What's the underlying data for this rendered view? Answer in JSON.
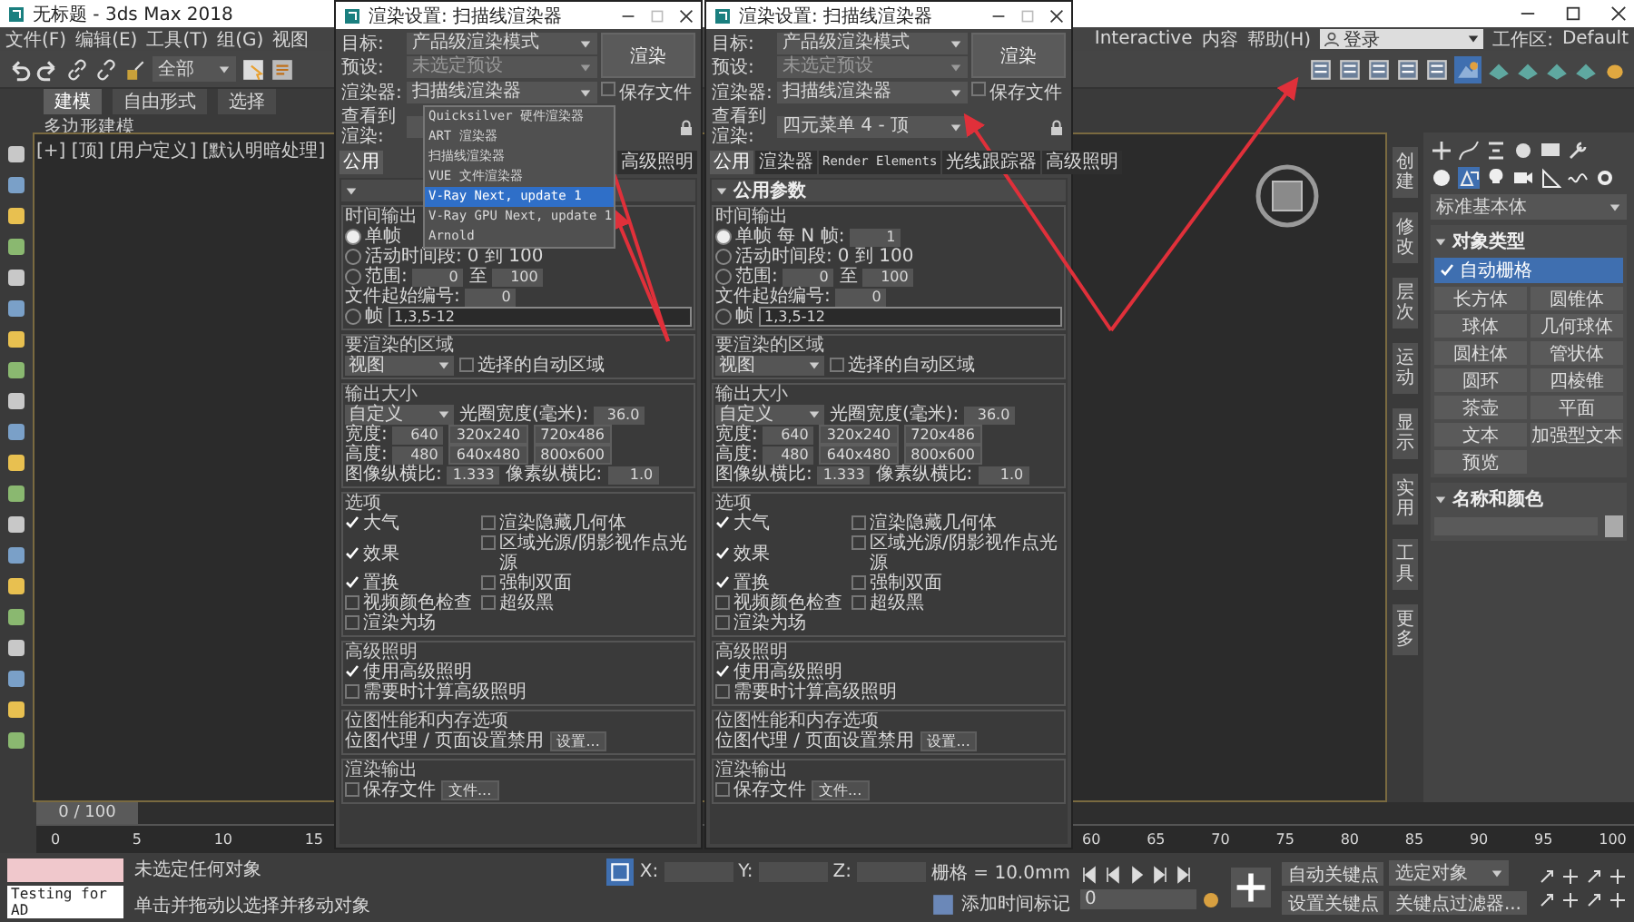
{
  "app": {
    "title": "无标题 - 3ds Max 2018",
    "menu_left": [
      "文件(F)",
      "编辑(E)",
      "工具(T)",
      "组(G)",
      "视图"
    ],
    "menu_right": [
      "Interactive",
      "内容",
      "帮助(H)"
    ],
    "sign_in": "登录",
    "workspace_label": "工作区:",
    "workspace": "Default",
    "selection_filter": "全部",
    "ribbon_tabs": [
      {
        "label": "建模",
        "selected": true
      },
      {
        "label": "自由形式",
        "selected": false
      },
      {
        "label": "选择",
        "selected": false
      }
    ],
    "ribbon_sub": "多边形建模",
    "viewport_label": "[+] [顶] [用户定义] [默认明暗处理]",
    "side_tabs": [
      "创建",
      "修改",
      "层次",
      "运动",
      "显示",
      "实用",
      "工具",
      "更多"
    ],
    "command_panel": {
      "category": "标准基本体",
      "rollout": "对象类型",
      "autogrid": {
        "label": "自动栅格",
        "checked": true
      },
      "objects": [
        "长方体",
        "圆锥体",
        "球体",
        "几何球体",
        "圆柱体",
        "管状体",
        "圆环",
        "四棱锥",
        "茶壶",
        "平面",
        "文本",
        "加强型文本",
        "预览"
      ],
      "name_rollout": "名称和颜色"
    },
    "timeline": {
      "slider": "0 / 100",
      "level": 0,
      "left_ticks": [
        "0",
        "5",
        "10",
        "15"
      ],
      "right_ticks": [
        "60",
        "65",
        "70",
        "75",
        "80",
        "85",
        "90",
        "95",
        "100"
      ]
    },
    "status": {
      "script": "Testing for AD",
      "line1": "未选定任何对象",
      "line2": "单击并拖动以选择并移动对象",
      "x_label": "X:",
      "y_label": "Y:",
      "z_label": "Z:",
      "grid": "栅格 = 10.0mm",
      "time_tag": "添加时间标记",
      "frame": "0",
      "auto_key": "自动关键点",
      "selected_obj": "选定对象",
      "set_key": "设置关键点",
      "key_filters": "关键点过滤器..."
    }
  },
  "dialogs": [
    {
      "title": "渲染设置: 扫描线渲染器",
      "target_label": "目标:",
      "target": "产品级渲染模式",
      "preset_label": "预设:",
      "preset": "未选定预设",
      "renderer_label": "渲染器:",
      "renderer": "扫描线渲染器",
      "save_file": {
        "label": "保存文件",
        "checked": false
      },
      "view_label": "查看到渲染:",
      "render_button": "渲染",
      "tabs": [
        {
          "label": "公用",
          "selected": true
        },
        {
          "label": "高级照明",
          "selected": false
        }
      ],
      "dropdown": [
        {
          "label": "Quicksilver 硬件渲染器",
          "selected": false
        },
        {
          "label": "ART 渲染器",
          "selected": false
        },
        {
          "label": "扫描线渲染器",
          "selected": false
        },
        {
          "label": "VUE 文件渲染器",
          "selected": false
        },
        {
          "label": "V-Ray Next, update 1",
          "selected": true
        },
        {
          "label": "V-Ray GPU Next, update 1",
          "selected": false
        },
        {
          "label": "Arnold",
          "selected": false
        }
      ],
      "sections": [
        {
          "heading": "时间输出",
          "rows": [
            {
              "items": [
                {
                  "kind": "radio",
                  "label": "单帧",
                  "selected": true
                }
              ]
            },
            {
              "items": [
                {
                  "kind": "radio",
                  "label": "活动时间段:",
                  "selected": false
                },
                {
                  "kind": "text",
                  "text": "0 到 100"
                }
              ]
            },
            {
              "items": [
                {
                  "kind": "radio",
                  "label": "范围:",
                  "selected": false
                },
                {
                  "kind": "field",
                  "value": "0"
                },
                {
                  "kind": "text",
                  "text": "至"
                },
                {
                  "kind": "field",
                  "value": "100"
                }
              ]
            },
            {
              "items": [
                {
                  "kind": "text",
                  "text": "文件起始编号:"
                },
                {
                  "kind": "field",
                  "value": "0"
                }
              ]
            },
            {
              "items": [
                {
                  "kind": "radio",
                  "label": "帧",
                  "selected": false
                },
                {
                  "kind": "input",
                  "value": "1,3,5-12"
                }
              ]
            }
          ]
        },
        {
          "heading": "要渲染的区域",
          "rows": [
            {
              "items": [
                {
                  "kind": "select",
                  "value": "视图"
                },
                {
                  "kind": "check",
                  "label": "选择的自动区域",
                  "checked": false
                }
              ]
            }
          ]
        },
        {
          "heading": "输出大小",
          "rows": [
            {
              "items": [
                {
                  "kind": "select",
                  "value": "自定义"
                },
                {
                  "kind": "text",
                  "text": "光圈宽度(毫米):"
                },
                {
                  "kind": "field",
                  "value": "36.0"
                }
              ]
            },
            {
              "items": [
                {
                  "kind": "text",
                  "text": "宽度:"
                },
                {
                  "kind": "field",
                  "value": "640"
                },
                {
                  "kind": "button",
                  "label": "320x240"
                },
                {
                  "kind": "button",
                  "label": "720x486"
                }
              ]
            },
            {
              "items": [
                {
                  "kind": "text",
                  "text": "高度:"
                },
                {
                  "kind": "field",
                  "value": "480"
                },
                {
                  "kind": "button",
                  "label": "640x480"
                },
                {
                  "kind": "button",
                  "label": "800x600"
                }
              ]
            },
            {
              "items": [
                {
                  "kind": "text",
                  "text": "图像纵横比:"
                },
                {
                  "kind": "field",
                  "value": "1.333"
                },
                {
                  "kind": "text",
                  "text": "像素纵横比:"
                },
                {
                  "kind": "field",
                  "value": "1.0"
                }
              ]
            }
          ]
        },
        {
          "heading": "选项",
          "rows": [
            {
              "items": [
                {
                  "kind": "check",
                  "label": "大气",
                  "checked": true
                },
                {
                  "kind": "check",
                  "label": "渲染隐藏几何体",
                  "checked": false
                }
              ]
            },
            {
              "items": [
                {
                  "kind": "check",
                  "label": "效果",
                  "checked": true
                },
                {
                  "kind": "check",
                  "label": "区域光源/阴影视作点光源",
                  "checked": false
                }
              ]
            },
            {
              "items": [
                {
                  "kind": "check",
                  "label": "置换",
                  "checked": true
                },
                {
                  "kind": "check",
                  "label": "强制双面",
                  "checked": false
                }
              ]
            },
            {
              "items": [
                {
                  "kind": "check",
                  "label": "视频颜色检查",
                  "checked": false
                },
                {
                  "kind": "check",
                  "label": "超级黑",
                  "checked": false
                }
              ]
            },
            {
              "items": [
                {
                  "kind": "check",
                  "label": "渲染为场",
                  "checked": false
                }
              ]
            }
          ]
        },
        {
          "heading": "高级照明",
          "rows": [
            {
              "items": [
                {
                  "kind": "check",
                  "label": "使用高级照明",
                  "checked": true
                }
              ]
            },
            {
              "items": [
                {
                  "kind": "check",
                  "label": "需要时计算高级照明",
                  "checked": false
                }
              ]
            }
          ]
        },
        {
          "heading": "位图性能和内存选项",
          "rows": [
            {
              "items": [
                {
                  "kind": "text",
                  "text": "位图代理 / 页面设置禁用"
                },
                {
                  "kind": "button",
                  "label": "设置..."
                }
              ]
            }
          ]
        },
        {
          "heading": "渲染输出",
          "rows": [
            {
              "items": [
                {
                  "kind": "check",
                  "label": "保存文件",
                  "checked": false
                },
                {
                  "kind": "button",
                  "label": "文件..."
                }
              ]
            }
          ]
        }
      ]
    },
    {
      "title": "渲染设置: 扫描线渲染器",
      "target_label": "目标:",
      "target": "产品级渲染模式",
      "preset_label": "预设:",
      "preset": "未选定预设",
      "renderer_label": "渲染器:",
      "renderer": "扫描线渲染器",
      "save_file": {
        "label": "保存文件",
        "checked": false
      },
      "view_label": "查看到渲染:",
      "view": "四元菜单 4 - 顶",
      "render_button": "渲染",
      "tabs": [
        {
          "label": "公用",
          "selected": true
        },
        {
          "label": "渲染器",
          "selected": false
        },
        {
          "label": "Render Elements",
          "selected": false
        },
        {
          "label": "光线跟踪器",
          "selected": false
        },
        {
          "label": "高级照明",
          "selected": false
        }
      ],
      "rollout": "公用参数",
      "sections": [
        {
          "heading": "时间输出",
          "rows": [
            {
              "items": [
                {
                  "kind": "radio",
                  "label": "单帧",
                  "selected": true
                },
                {
                  "kind": "text",
                  "text": "每 N 帧:"
                },
                {
                  "kind": "field",
                  "value": "1"
                }
              ]
            },
            {
              "items": [
                {
                  "kind": "radio",
                  "label": "活动时间段:",
                  "selected": false
                },
                {
                  "kind": "text",
                  "text": "0 到 100"
                }
              ]
            },
            {
              "items": [
                {
                  "kind": "radio",
                  "label": "范围:",
                  "selected": false
                },
                {
                  "kind": "field",
                  "value": "0"
                },
                {
                  "kind": "text",
                  "text": "至"
                },
                {
                  "kind": "field",
                  "value": "100"
                }
              ]
            },
            {
              "items": [
                {
                  "kind": "text",
                  "text": "文件起始编号:"
                },
                {
                  "kind": "field",
                  "value": "0"
                }
              ]
            },
            {
              "items": [
                {
                  "kind": "radio",
                  "label": "帧",
                  "selected": false
                },
                {
                  "kind": "input",
                  "value": "1,3,5-12"
                }
              ]
            }
          ]
        },
        {
          "heading": "要渲染的区域",
          "rows": [
            {
              "items": [
                {
                  "kind": "select",
                  "value": "视图"
                },
                {
                  "kind": "check",
                  "label": "选择的自动区域",
                  "checked": false
                }
              ]
            }
          ]
        },
        {
          "heading": "输出大小",
          "rows": [
            {
              "items": [
                {
                  "kind": "select",
                  "value": "自定义"
                },
                {
                  "kind": "text",
                  "text": "光圈宽度(毫米):"
                },
                {
                  "kind": "field",
                  "value": "36.0"
                }
              ]
            },
            {
              "items": [
                {
                  "kind": "text",
                  "text": "宽度:"
                },
                {
                  "kind": "field",
                  "value": "640"
                },
                {
                  "kind": "button",
                  "label": "320x240"
                },
                {
                  "kind": "button",
                  "label": "720x486"
                }
              ]
            },
            {
              "items": [
                {
                  "kind": "text",
                  "text": "高度:"
                },
                {
                  "kind": "field",
                  "value": "480"
                },
                {
                  "kind": "button",
                  "label": "640x480"
                },
                {
                  "kind": "button",
                  "label": "800x600"
                }
              ]
            },
            {
              "items": [
                {
                  "kind": "text",
                  "text": "图像纵横比:"
                },
                {
                  "kind": "field",
                  "value": "1.333"
                },
                {
                  "kind": "text",
                  "text": "像素纵横比:"
                },
                {
                  "kind": "field",
                  "value": "1.0"
                }
              ]
            }
          ]
        },
        {
          "heading": "选项",
          "rows": [
            {
              "items": [
                {
                  "kind": "check",
                  "label": "大气",
                  "checked": true
                },
                {
                  "kind": "check",
                  "label": "渲染隐藏几何体",
                  "checked": false
                }
              ]
            },
            {
              "items": [
                {
                  "kind": "check",
                  "label": "效果",
                  "checked": true
                },
                {
                  "kind": "check",
                  "label": "区域光源/阴影视作点光源",
                  "checked": false
                }
              ]
            },
            {
              "items": [
                {
                  "kind": "check",
                  "label": "置换",
                  "checked": true
                },
                {
                  "kind": "check",
                  "label": "强制双面",
                  "checked": false
                }
              ]
            },
            {
              "items": [
                {
                  "kind": "check",
                  "label": "视频颜色检查",
                  "checked": false
                },
                {
                  "kind": "check",
                  "label": "超级黑",
                  "checked": false
                }
              ]
            },
            {
              "items": [
                {
                  "kind": "check",
                  "label": "渲染为场",
                  "checked": false
                }
              ]
            }
          ]
        },
        {
          "heading": "高级照明",
          "rows": [
            {
              "items": [
                {
                  "kind": "check",
                  "label": "使用高级照明",
                  "checked": true
                }
              ]
            },
            {
              "items": [
                {
                  "kind": "check",
                  "label": "需要时计算高级照明",
                  "checked": false
                }
              ]
            }
          ]
        },
        {
          "heading": "位图性能和内存选项",
          "rows": [
            {
              "items": [
                {
                  "kind": "text",
                  "text": "位图代理 / 页面设置禁用"
                },
                {
                  "kind": "button",
                  "label": "设置..."
                }
              ]
            }
          ]
        },
        {
          "heading": "渲染输出",
          "rows": [
            {
              "items": [
                {
                  "kind": "check",
                  "label": "保存文件",
                  "checked": false
                },
                {
                  "kind": "button",
                  "label": "文件..."
                }
              ]
            }
          ]
        }
      ]
    }
  ]
}
